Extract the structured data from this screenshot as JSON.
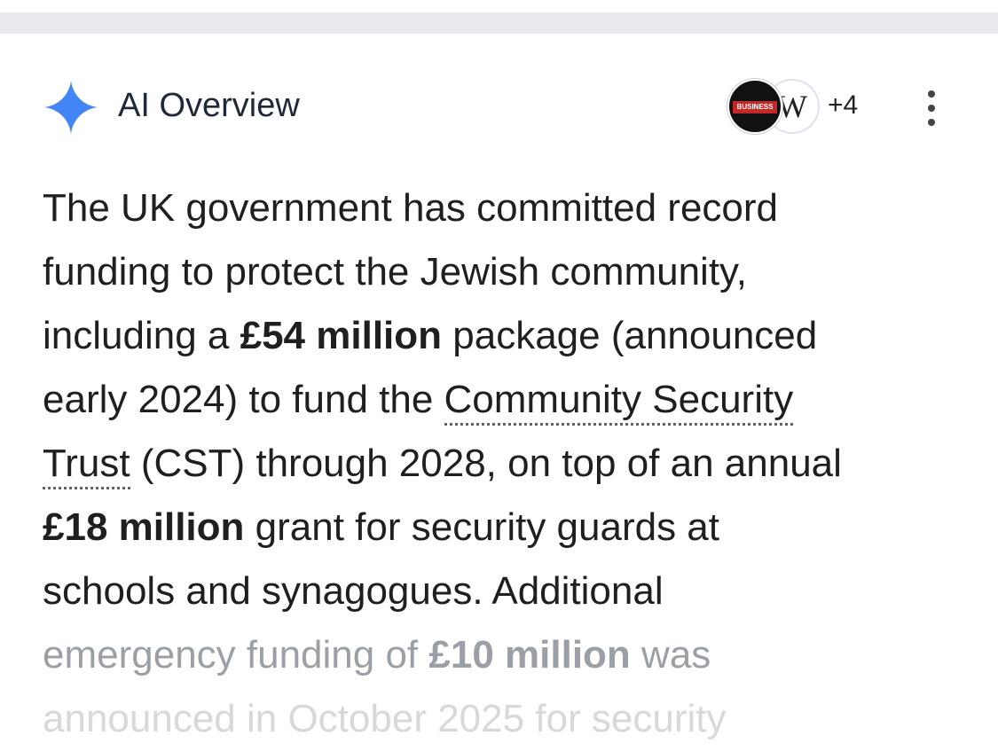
{
  "header": {
    "title": "AI Overview",
    "source_avatars": [
      "business-logo",
      "wikipedia-logo"
    ],
    "more_sources": "+4"
  },
  "colors": {
    "sparkle_blue": "#4285f4",
    "text": "#1f1f1f",
    "faded_text": "#9aa0a6"
  },
  "overview": {
    "l1": "The UK government has committed record",
    "l2": "funding to protect the Jewish community,",
    "l3a": "including a ",
    "l3b": "£54 million",
    "l3c": " package (announced",
    "l4a": "early 2024) to fund the ",
    "l4b": "Community Security",
    "l5a": "Trust",
    "l5b": " (CST) through 2028, on top of an annual",
    "l6a": "£18 million",
    "l6b": " grant for security guards at",
    "l7": "schools and synagogues. Additional",
    "l8a": "emergency funding of ",
    "l8b": "£10 million",
    "l8c": " was",
    "l9": "announced in October 2025 for security"
  }
}
